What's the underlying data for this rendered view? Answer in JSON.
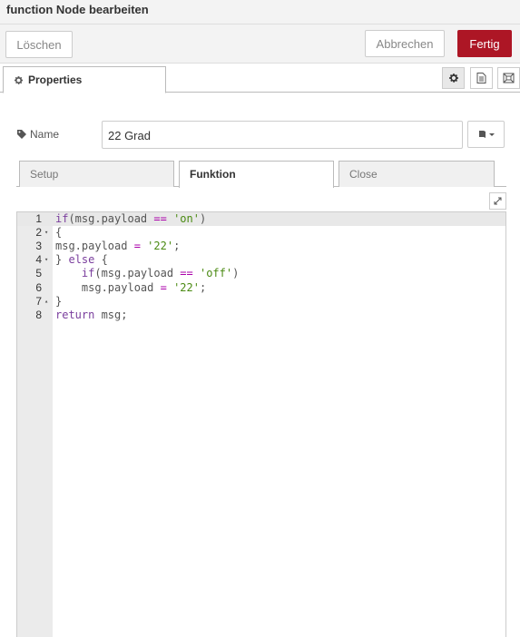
{
  "tray": {
    "title": "function Node bearbeiten"
  },
  "toolbar": {
    "delete_label": "Löschen",
    "cancel_label": "Abbrechen",
    "done_label": "Fertig",
    "done_color": "#ad1625"
  },
  "tabs": {
    "properties_label": "Properties",
    "icons": [
      "gear-icon",
      "document-icon",
      "node-appearance-icon"
    ]
  },
  "name": {
    "label": "Name",
    "value": "22 Grad",
    "icon_select": "book-icon"
  },
  "subtabs": [
    {
      "label": "Setup",
      "active": false
    },
    {
      "label": "Funktion",
      "active": true
    },
    {
      "label": "Close",
      "active": false
    }
  ],
  "editor": {
    "lines": [
      {
        "number": "1",
        "fold": "",
        "text": "if(msg.payload == 'on')"
      },
      {
        "number": "2",
        "fold": "▾",
        "text": "{"
      },
      {
        "number": "3",
        "fold": "",
        "text": "msg.payload = '22';"
      },
      {
        "number": "4",
        "fold": "▾",
        "text": "} else {"
      },
      {
        "number": "5",
        "fold": "",
        "text": "    if(msg.payload == 'off')"
      },
      {
        "number": "6",
        "fold": "",
        "text": "    msg.payload = '22';"
      },
      {
        "number": "7",
        "fold": "▴",
        "text": "}"
      },
      {
        "number": "8",
        "fold": "",
        "text": "return msg;"
      }
    ]
  }
}
